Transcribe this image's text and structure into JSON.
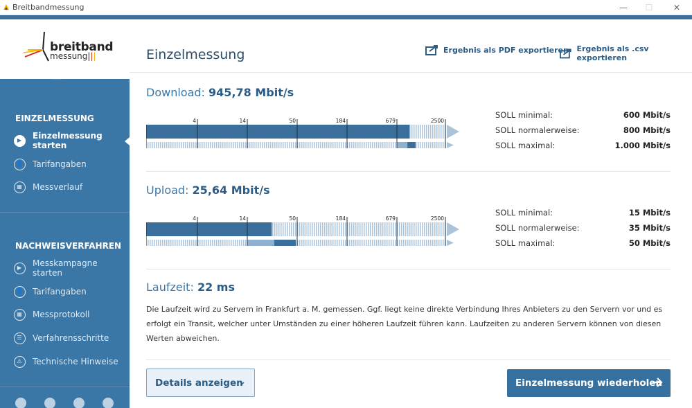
{
  "window": {
    "title": "Breitbandmessung",
    "minimize": "—",
    "maximize": "☐",
    "close": "✕"
  },
  "logo": {
    "line1": "breitband",
    "line2": "messung"
  },
  "sidebar": {
    "section1": {
      "heading": "EINZELMESSUNG",
      "items": [
        {
          "label": "Einzelmessung starten",
          "icon": "play-icon",
          "active": true
        },
        {
          "label": "Tarifangaben",
          "icon": "user-icon"
        },
        {
          "label": "Messverlauf",
          "icon": "calendar-icon"
        }
      ]
    },
    "section2": {
      "heading": "NACHWEISVERFAHREN",
      "items": [
        {
          "label": "Messkampagne starten",
          "icon": "play-icon"
        },
        {
          "label": "Tarifangaben",
          "icon": "user-icon"
        },
        {
          "label": "Messprotokoll",
          "icon": "calendar-icon"
        },
        {
          "label": "Verfahrensschritte",
          "icon": "list-icon"
        },
        {
          "label": "Technische Hinweise",
          "icon": "warning-icon"
        }
      ]
    },
    "bottom_icons": [
      "home-icon",
      "chat-icon",
      "info-icon",
      "gear-icon"
    ]
  },
  "main": {
    "title": "Einzelmessung",
    "export_pdf": "Ergebnis als PDF exportieren",
    "export_csv": "Ergebnis als .csv exportieren",
    "download": {
      "label": "Download:",
      "value": "945,78 Mbit/s",
      "measured_fraction": 0.88,
      "soll_fraction_min": 0.84,
      "soll_fraction_max": 0.9,
      "ticks": [
        "4",
        "14",
        "50",
        "184",
        "679",
        "2500"
      ],
      "soll": [
        {
          "label": "SOLL minimal:",
          "value": "600 Mbit/s"
        },
        {
          "label": "SOLL normalerweise:",
          "value": "800 Mbit/s"
        },
        {
          "label": "SOLL maximal:",
          "value": "1.000 Mbit/s"
        }
      ]
    },
    "upload": {
      "label": "Upload:",
      "value": "25,64 Mbit/s",
      "measured_fraction": 0.42,
      "soll_fraction_min": 0.34,
      "soll_fraction_max": 0.5,
      "ticks": [
        "4",
        "14",
        "50",
        "184",
        "679",
        "2500"
      ],
      "soll": [
        {
          "label": "SOLL minimal:",
          "value": "15 Mbit/s"
        },
        {
          "label": "SOLL normalerweise:",
          "value": "35 Mbit/s"
        },
        {
          "label": "SOLL maximal:",
          "value": "50 Mbit/s"
        }
      ]
    },
    "laufzeit": {
      "label": "Laufzeit:",
      "value": "22 ms",
      "text": "Die Laufzeit wird zu Servern in Frankfurt a. M. gemessen. Ggf. liegt keine direkte Verbindung Ihres Anbieters zu den Servern vor und es erfolgt ein Transit, welcher unter Umständen zu einer höheren Laufzeit führen kann. Laufzeiten zu anderen Servern können von diesen Werten abweichen."
    },
    "details_button": "Details anzeigen",
    "repeat_button": "Einzelmessung wiederholen"
  },
  "colors": {
    "accent": "#3a76a6",
    "dark": "#2b5c86",
    "light": "#a9c3da"
  }
}
